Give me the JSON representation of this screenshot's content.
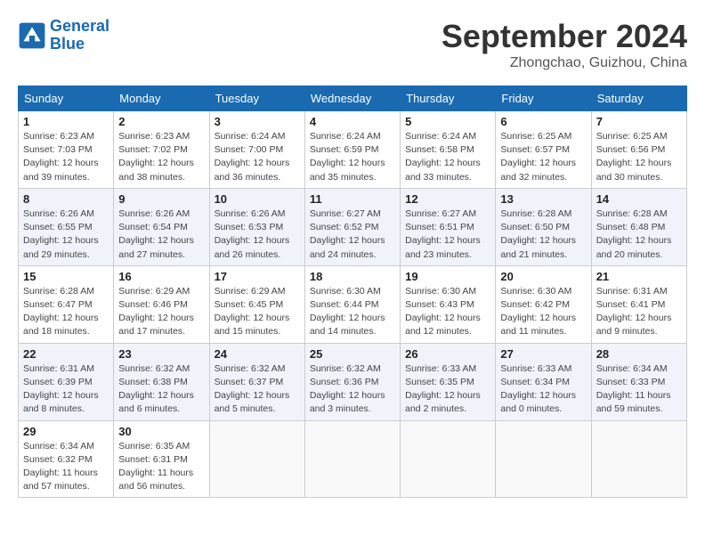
{
  "header": {
    "logo_line1": "General",
    "logo_line2": "Blue",
    "month_title": "September 2024",
    "location": "Zhongchao, Guizhou, China"
  },
  "weekdays": [
    "Sunday",
    "Monday",
    "Tuesday",
    "Wednesday",
    "Thursday",
    "Friday",
    "Saturday"
  ],
  "weeks": [
    [
      {
        "day": "1",
        "detail": "Sunrise: 6:23 AM\nSunset: 7:03 PM\nDaylight: 12 hours\nand 39 minutes."
      },
      {
        "day": "2",
        "detail": "Sunrise: 6:23 AM\nSunset: 7:02 PM\nDaylight: 12 hours\nand 38 minutes."
      },
      {
        "day": "3",
        "detail": "Sunrise: 6:24 AM\nSunset: 7:00 PM\nDaylight: 12 hours\nand 36 minutes."
      },
      {
        "day": "4",
        "detail": "Sunrise: 6:24 AM\nSunset: 6:59 PM\nDaylight: 12 hours\nand 35 minutes."
      },
      {
        "day": "5",
        "detail": "Sunrise: 6:24 AM\nSunset: 6:58 PM\nDaylight: 12 hours\nand 33 minutes."
      },
      {
        "day": "6",
        "detail": "Sunrise: 6:25 AM\nSunset: 6:57 PM\nDaylight: 12 hours\nand 32 minutes."
      },
      {
        "day": "7",
        "detail": "Sunrise: 6:25 AM\nSunset: 6:56 PM\nDaylight: 12 hours\nand 30 minutes."
      }
    ],
    [
      {
        "day": "8",
        "detail": "Sunrise: 6:26 AM\nSunset: 6:55 PM\nDaylight: 12 hours\nand 29 minutes."
      },
      {
        "day": "9",
        "detail": "Sunrise: 6:26 AM\nSunset: 6:54 PM\nDaylight: 12 hours\nand 27 minutes."
      },
      {
        "day": "10",
        "detail": "Sunrise: 6:26 AM\nSunset: 6:53 PM\nDaylight: 12 hours\nand 26 minutes."
      },
      {
        "day": "11",
        "detail": "Sunrise: 6:27 AM\nSunset: 6:52 PM\nDaylight: 12 hours\nand 24 minutes."
      },
      {
        "day": "12",
        "detail": "Sunrise: 6:27 AM\nSunset: 6:51 PM\nDaylight: 12 hours\nand 23 minutes."
      },
      {
        "day": "13",
        "detail": "Sunrise: 6:28 AM\nSunset: 6:50 PM\nDaylight: 12 hours\nand 21 minutes."
      },
      {
        "day": "14",
        "detail": "Sunrise: 6:28 AM\nSunset: 6:48 PM\nDaylight: 12 hours\nand 20 minutes."
      }
    ],
    [
      {
        "day": "15",
        "detail": "Sunrise: 6:28 AM\nSunset: 6:47 PM\nDaylight: 12 hours\nand 18 minutes."
      },
      {
        "day": "16",
        "detail": "Sunrise: 6:29 AM\nSunset: 6:46 PM\nDaylight: 12 hours\nand 17 minutes."
      },
      {
        "day": "17",
        "detail": "Sunrise: 6:29 AM\nSunset: 6:45 PM\nDaylight: 12 hours\nand 15 minutes."
      },
      {
        "day": "18",
        "detail": "Sunrise: 6:30 AM\nSunset: 6:44 PM\nDaylight: 12 hours\nand 14 minutes."
      },
      {
        "day": "19",
        "detail": "Sunrise: 6:30 AM\nSunset: 6:43 PM\nDaylight: 12 hours\nand 12 minutes."
      },
      {
        "day": "20",
        "detail": "Sunrise: 6:30 AM\nSunset: 6:42 PM\nDaylight: 12 hours\nand 11 minutes."
      },
      {
        "day": "21",
        "detail": "Sunrise: 6:31 AM\nSunset: 6:41 PM\nDaylight: 12 hours\nand 9 minutes."
      }
    ],
    [
      {
        "day": "22",
        "detail": "Sunrise: 6:31 AM\nSunset: 6:39 PM\nDaylight: 12 hours\nand 8 minutes."
      },
      {
        "day": "23",
        "detail": "Sunrise: 6:32 AM\nSunset: 6:38 PM\nDaylight: 12 hours\nand 6 minutes."
      },
      {
        "day": "24",
        "detail": "Sunrise: 6:32 AM\nSunset: 6:37 PM\nDaylight: 12 hours\nand 5 minutes."
      },
      {
        "day": "25",
        "detail": "Sunrise: 6:32 AM\nSunset: 6:36 PM\nDaylight: 12 hours\nand 3 minutes."
      },
      {
        "day": "26",
        "detail": "Sunrise: 6:33 AM\nSunset: 6:35 PM\nDaylight: 12 hours\nand 2 minutes."
      },
      {
        "day": "27",
        "detail": "Sunrise: 6:33 AM\nSunset: 6:34 PM\nDaylight: 12 hours\nand 0 minutes."
      },
      {
        "day": "28",
        "detail": "Sunrise: 6:34 AM\nSunset: 6:33 PM\nDaylight: 11 hours\nand 59 minutes."
      }
    ],
    [
      {
        "day": "29",
        "detail": "Sunrise: 6:34 AM\nSunset: 6:32 PM\nDaylight: 11 hours\nand 57 minutes."
      },
      {
        "day": "30",
        "detail": "Sunrise: 6:35 AM\nSunset: 6:31 PM\nDaylight: 11 hours\nand 56 minutes."
      },
      null,
      null,
      null,
      null,
      null
    ]
  ]
}
